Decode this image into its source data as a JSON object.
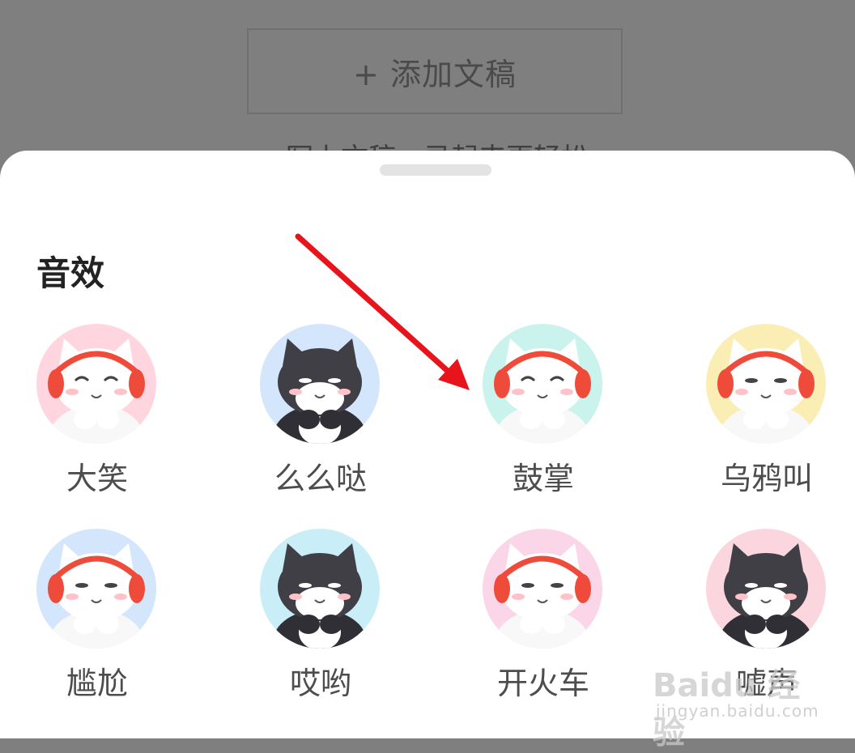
{
  "background": {
    "add_draft_label": "+ 添加文稿",
    "hint_text": "写上文稿，录起来更轻松"
  },
  "sheet": {
    "title": "音效",
    "items": [
      {
        "label": "大笑",
        "icon": "laughing-cat-icon",
        "bg": "#ffd6df",
        "cat": "white"
      },
      {
        "label": "么么哒",
        "icon": "kissing-cat-icon",
        "bg": "#d3e6fb",
        "cat": "black"
      },
      {
        "label": "鼓掌",
        "icon": "clapping-cat-icon",
        "bg": "#c9f3ec",
        "cat": "white"
      },
      {
        "label": "乌鸦叫",
        "icon": "crow-cat-icon",
        "bg": "#fbeeb4",
        "cat": "white"
      },
      {
        "label": "尴尬",
        "icon": "awkward-cat-icon",
        "bg": "#d3e6fb",
        "cat": "white"
      },
      {
        "label": "哎哟",
        "icon": "ouch-cat-icon",
        "bg": "#c9eef8",
        "cat": "black"
      },
      {
        "label": "开火车",
        "icon": "train-cat-icon",
        "bg": "#fbd6e8",
        "cat": "white"
      },
      {
        "label": "嘘声",
        "icon": "boo-cat-icon",
        "bg": "#fbd6df",
        "cat": "black"
      }
    ]
  },
  "watermark": {
    "brand": "Baidu 经验",
    "url": "jingyan.baidu.com"
  },
  "colors": {
    "annotation_arrow": "#e8141b",
    "headphone_red": "#ef4b3a"
  }
}
